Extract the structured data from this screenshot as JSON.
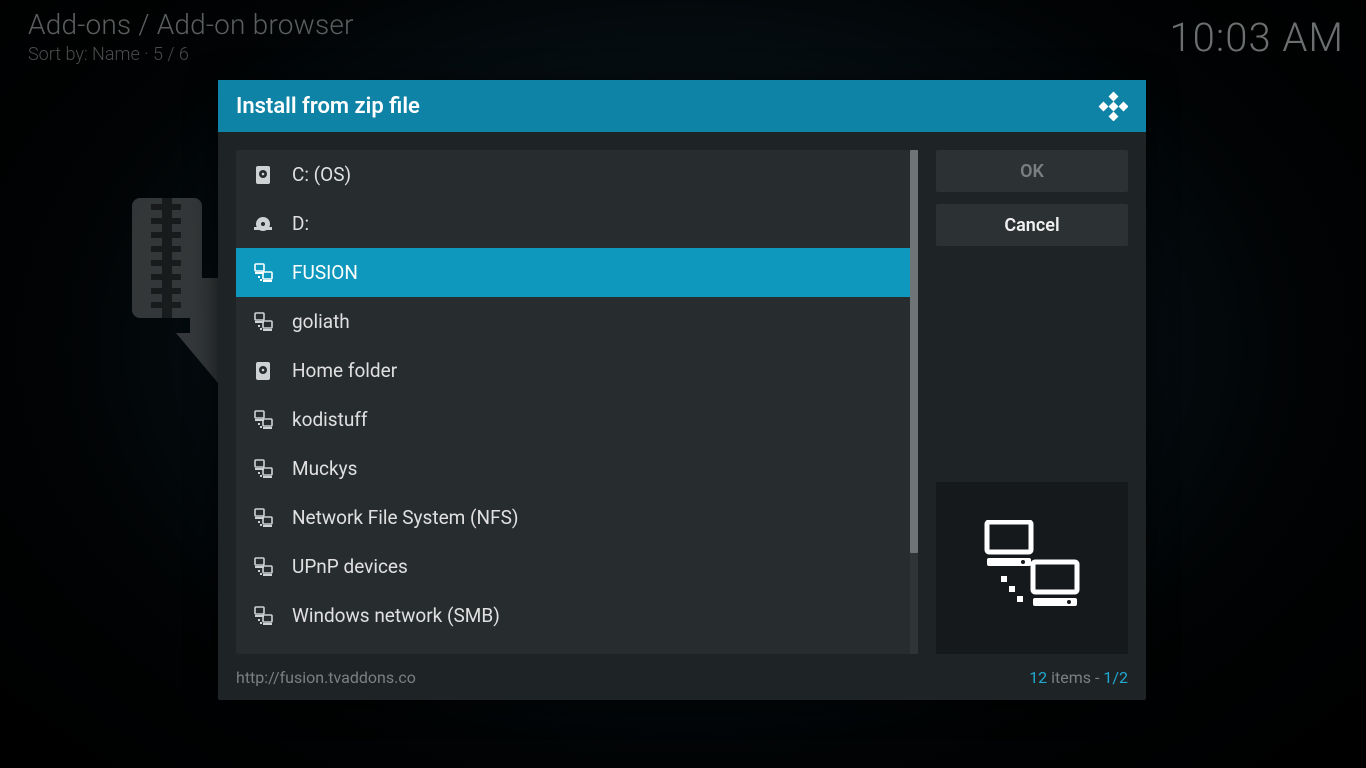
{
  "background": {
    "breadcrumb": "Add-ons / Add-on browser",
    "sortline": "Sort by: Name  ·  5 / 6",
    "clock": "10:03 AM"
  },
  "dialog": {
    "title": "Install from zip file",
    "items": [
      {
        "label": "C: (OS)",
        "icon": "hdd",
        "selected": false
      },
      {
        "label": "D:",
        "icon": "disc",
        "selected": false
      },
      {
        "label": "FUSION",
        "icon": "network",
        "selected": true
      },
      {
        "label": "goliath",
        "icon": "network",
        "selected": false
      },
      {
        "label": "Home folder",
        "icon": "hdd",
        "selected": false
      },
      {
        "label": "kodistuff",
        "icon": "network",
        "selected": false
      },
      {
        "label": "Muckys",
        "icon": "network",
        "selected": false
      },
      {
        "label": "Network File System (NFS)",
        "icon": "network",
        "selected": false
      },
      {
        "label": "UPnP devices",
        "icon": "network",
        "selected": false
      },
      {
        "label": "Windows network (SMB)",
        "icon": "network",
        "selected": false
      }
    ],
    "buttons": {
      "ok": "OK",
      "cancel": "Cancel"
    },
    "footer": {
      "path": "http://fusion.tvaddons.co",
      "count": "12",
      "count_suffix": " items - ",
      "page": "1/2"
    }
  }
}
